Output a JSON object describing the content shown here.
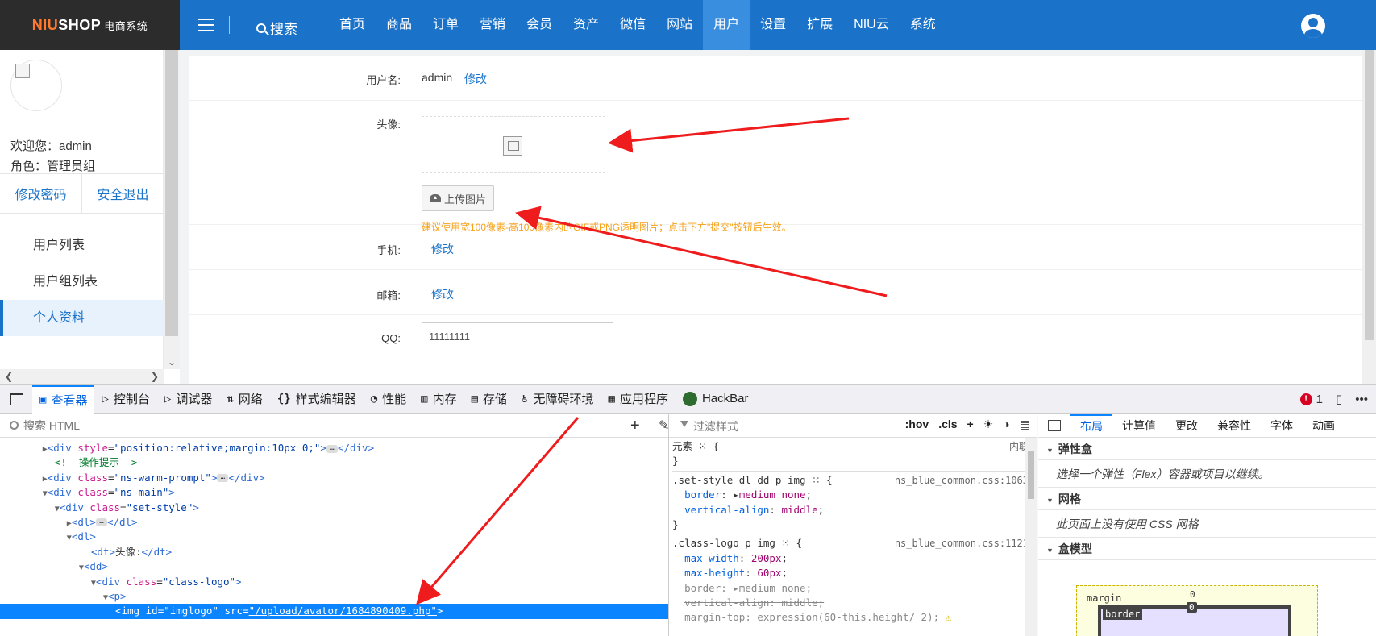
{
  "app": {
    "logo_brand_1": "NIU",
    "logo_brand_2": "SHOP",
    "logo_sub": "电商系统",
    "search_label": "搜索",
    "nav": [
      "首页",
      "商品",
      "订单",
      "营销",
      "会员",
      "资产",
      "微信",
      "网站",
      "用户",
      "设置",
      "扩展",
      "NIU云",
      "系统"
    ],
    "nav_active": "用户"
  },
  "sidebar": {
    "welcome": "欢迎您：admin",
    "role": "角色：管理员组",
    "change_password": "修改密码",
    "logout": "安全退出",
    "menu": [
      "用户列表",
      "用户组列表",
      "个人资料"
    ],
    "menu_active": "个人资料"
  },
  "profile": {
    "username_label": "用户名:",
    "username_value": "admin",
    "username_edit": "修改",
    "avatar_label": "头像:",
    "upload_label": "上传图片",
    "hint": "建议使用宽100像素-高100像素内的GIF或PNG透明图片；点击下方\"提交\"按钮后生效。",
    "phone_label": "手机:",
    "phone_edit": "修改",
    "email_label": "邮箱:",
    "email_edit": "修改",
    "qq_label": "QQ:",
    "qq_value": "11111111"
  },
  "devtools": {
    "tabs": [
      {
        "icon": "inspector-icon",
        "glyph": "▣",
        "label": "查看器"
      },
      {
        "icon": "console-icon",
        "glyph": "▷",
        "label": "控制台"
      },
      {
        "icon": "debugger-icon",
        "glyph": "▷",
        "label": "调试器"
      },
      {
        "icon": "network-icon",
        "glyph": "⇅",
        "label": "网络"
      },
      {
        "icon": "style-editor-icon",
        "glyph": "{}",
        "label": "样式编辑器"
      },
      {
        "icon": "performance-icon",
        "glyph": "◔",
        "label": "性能"
      },
      {
        "icon": "memory-icon",
        "glyph": "▥",
        "label": "内存"
      },
      {
        "icon": "storage-icon",
        "glyph": "▤",
        "label": "存储"
      },
      {
        "icon": "accessibility-icon",
        "glyph": "♿",
        "label": "无障碍环境"
      },
      {
        "icon": "application-icon",
        "glyph": "▦",
        "label": "应用程序"
      },
      {
        "icon": "hackbar-icon",
        "glyph": "",
        "label": "HackBar"
      }
    ],
    "active_tab": "查看器",
    "error_count": "1",
    "html_search_placeholder": "搜索 HTML",
    "css_filter_placeholder": "过滤样式",
    "css_tools": [
      ":hov",
      ".cls"
    ],
    "element_label": "元素",
    "inline_label": "内联",
    "layout_tabs": [
      "布局",
      "计算值",
      "更改",
      "兼容性",
      "字体",
      "动画"
    ],
    "layout_active": "布局",
    "flexbox_title": "弹性盒",
    "flexbox_hint": "选择一个弹性（Flex）容器或项目以继续。",
    "grid_title": "网格",
    "grid_hint": "此页面上没有使用 CSS 网格",
    "boxmodel_title": "盒模型",
    "box_margin_label": "margin",
    "box_margin_value": "0",
    "box_border_label": "border",
    "box_border_value": "0"
  }
}
